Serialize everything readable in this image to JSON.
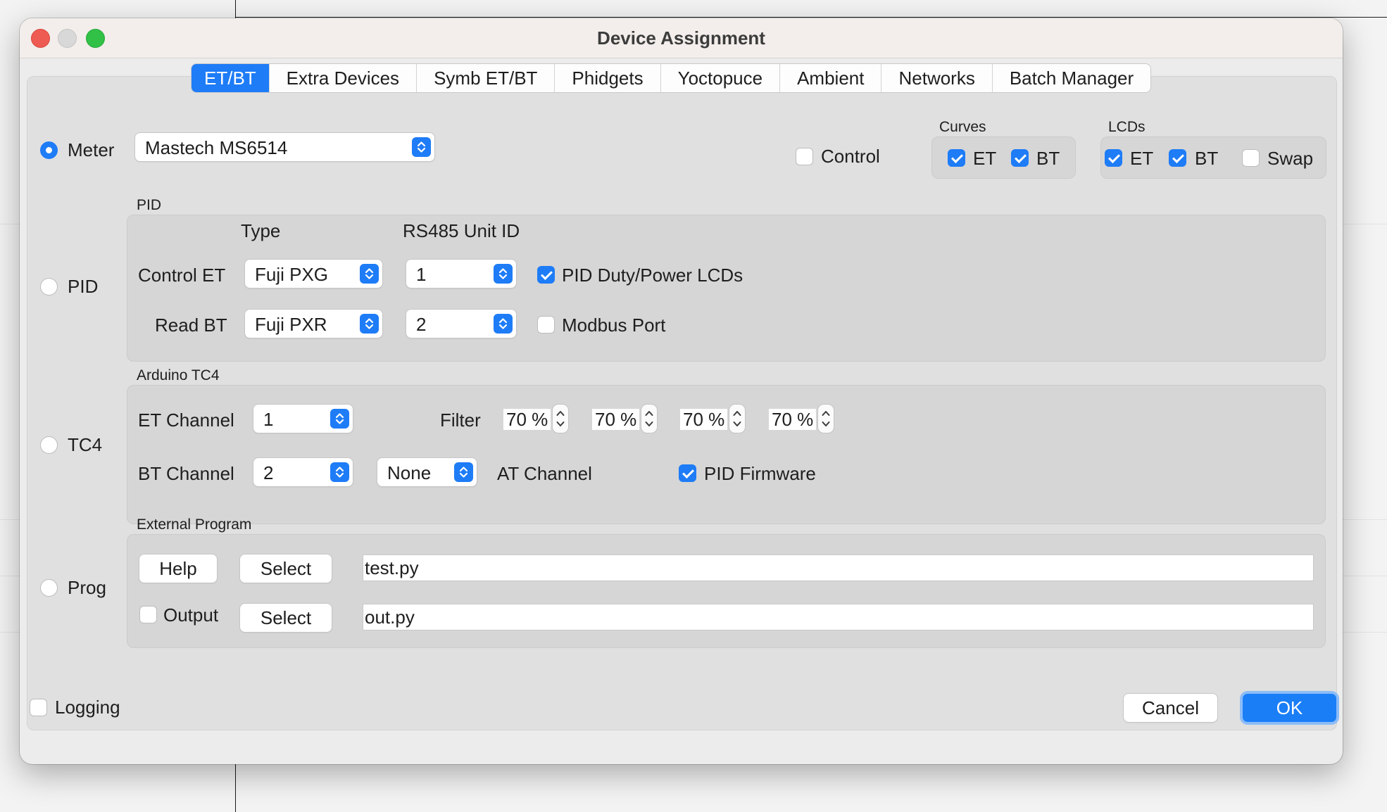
{
  "window": {
    "title": "Device Assignment"
  },
  "tabs": [
    "ET/BT",
    "Extra Devices",
    "Symb ET/BT",
    "Phidgets",
    "Yoctopuce",
    "Ambient",
    "Networks",
    "Batch Manager"
  ],
  "device_source": {
    "meter_label": "Meter",
    "pid_label": "PID",
    "tc4_label": "TC4",
    "prog_label": "Prog",
    "selected": "Meter"
  },
  "meter_select": {
    "value": "Mastech MS6514"
  },
  "control": {
    "label": "Control",
    "checked": false
  },
  "curves": {
    "title": "Curves",
    "et_label": "ET",
    "bt_label": "BT",
    "et_checked": true,
    "bt_checked": true
  },
  "lcds": {
    "title": "LCDs",
    "et_label": "ET",
    "bt_label": "BT",
    "swap_label": "Swap",
    "et_checked": true,
    "bt_checked": true,
    "swap_checked": false
  },
  "pid": {
    "title": "PID",
    "type_header": "Type",
    "unit_header": "RS485 Unit ID",
    "control_et_label": "Control ET",
    "read_bt_label": "Read BT",
    "control_et_type": "Fuji PXG",
    "read_bt_type": "Fuji PXR",
    "control_et_unit": "1",
    "read_bt_unit": "2",
    "duty_label": "PID Duty/Power LCDs",
    "duty_checked": true,
    "modbus_label": "Modbus Port",
    "modbus_checked": false
  },
  "tc4": {
    "title": "Arduino TC4",
    "et_channel_label": "ET Channel",
    "bt_channel_label": "BT Channel",
    "et_channel": "1",
    "bt_channel": "2",
    "at_channel": "None",
    "at_channel_label": "AT Channel",
    "filter_label": "Filter",
    "filters": [
      "70 %",
      "70 %",
      "70 %",
      "70 %"
    ],
    "pid_firmware_label": "PID Firmware",
    "pid_firmware_checked": true
  },
  "external_program": {
    "title": "External Program",
    "help_label": "Help",
    "select_label": "Select",
    "program": "test.py",
    "output_label": "Output",
    "output_checked": false,
    "output_select_label": "Select",
    "output_program": "out.py"
  },
  "footer": {
    "logging_label": "Logging",
    "logging_checked": false,
    "cancel_label": "Cancel",
    "ok_label": "OK"
  },
  "colors": {
    "accent": "#1e7cf7",
    "close": "#ee5b52",
    "minimize": "#d8d8d8",
    "zoom": "#31c147"
  },
  "icons": [
    "updown-chevron-icon",
    "spinner-arrows-icon",
    "checkmark-icon"
  ]
}
